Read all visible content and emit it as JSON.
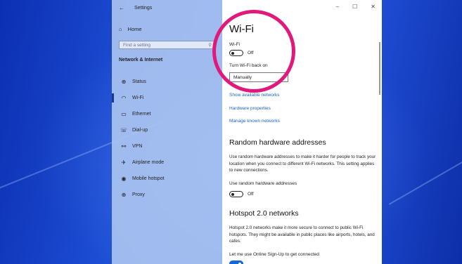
{
  "colors": {
    "accent": "#1a65c8",
    "highlight_circle": "#e0197a",
    "toggle_on": "#1668d8"
  },
  "titlebar": {
    "back_icon": "arrow-left-icon",
    "title": "Settings",
    "minimize": "–",
    "maximize": "☐",
    "close": "✕"
  },
  "sidebar": {
    "home_label": "Home",
    "search_placeholder": "Find a setting",
    "section_title": "Network & Internet",
    "items": [
      {
        "icon": "globe-status-icon",
        "glyph": "⊕",
        "label": "Status"
      },
      {
        "icon": "wifi-icon",
        "glyph": "◠",
        "label": "Wi-Fi"
      },
      {
        "icon": "ethernet-icon",
        "glyph": "▭",
        "label": "Ethernet"
      },
      {
        "icon": "dialup-icon",
        "glyph": "☏",
        "label": "Dial-up"
      },
      {
        "icon": "vpn-icon",
        "glyph": "⚯",
        "label": "VPN"
      },
      {
        "icon": "airplane-icon",
        "glyph": "✈",
        "label": "Airplane mode"
      },
      {
        "icon": "hotspot-icon",
        "glyph": "◉",
        "label": "Mobile hotspot"
      },
      {
        "icon": "proxy-icon",
        "glyph": "⊕",
        "label": "Proxy"
      }
    ]
  },
  "main": {
    "title": "Wi-Fi",
    "wifi_label": "Wi-Fi",
    "wifi_state": "Off",
    "turn_back_label": "Turn Wi-Fi back on",
    "turn_back_value": "Manually",
    "links": [
      "Show available networks",
      "Hardware properties",
      "Manage known networks"
    ],
    "random_title": "Random hardware addresses",
    "random_desc": "Use random hardware addresses to make it harder for people to track your location when you connect to different Wi-Fi networks. This setting applies to new connections.",
    "random_toggle_label": "Use random hardware addresses",
    "random_state": "Off",
    "hotspot_title": "Hotspot 2.0 networks",
    "hotspot_desc": "Hotspot 2.0 networks make it more secure to connect to public Wi-Fi hotspots. They might be available in public places like airports, hotels, and cafes.",
    "signup_label": "Let me use Online Sign-Up to get connected"
  }
}
